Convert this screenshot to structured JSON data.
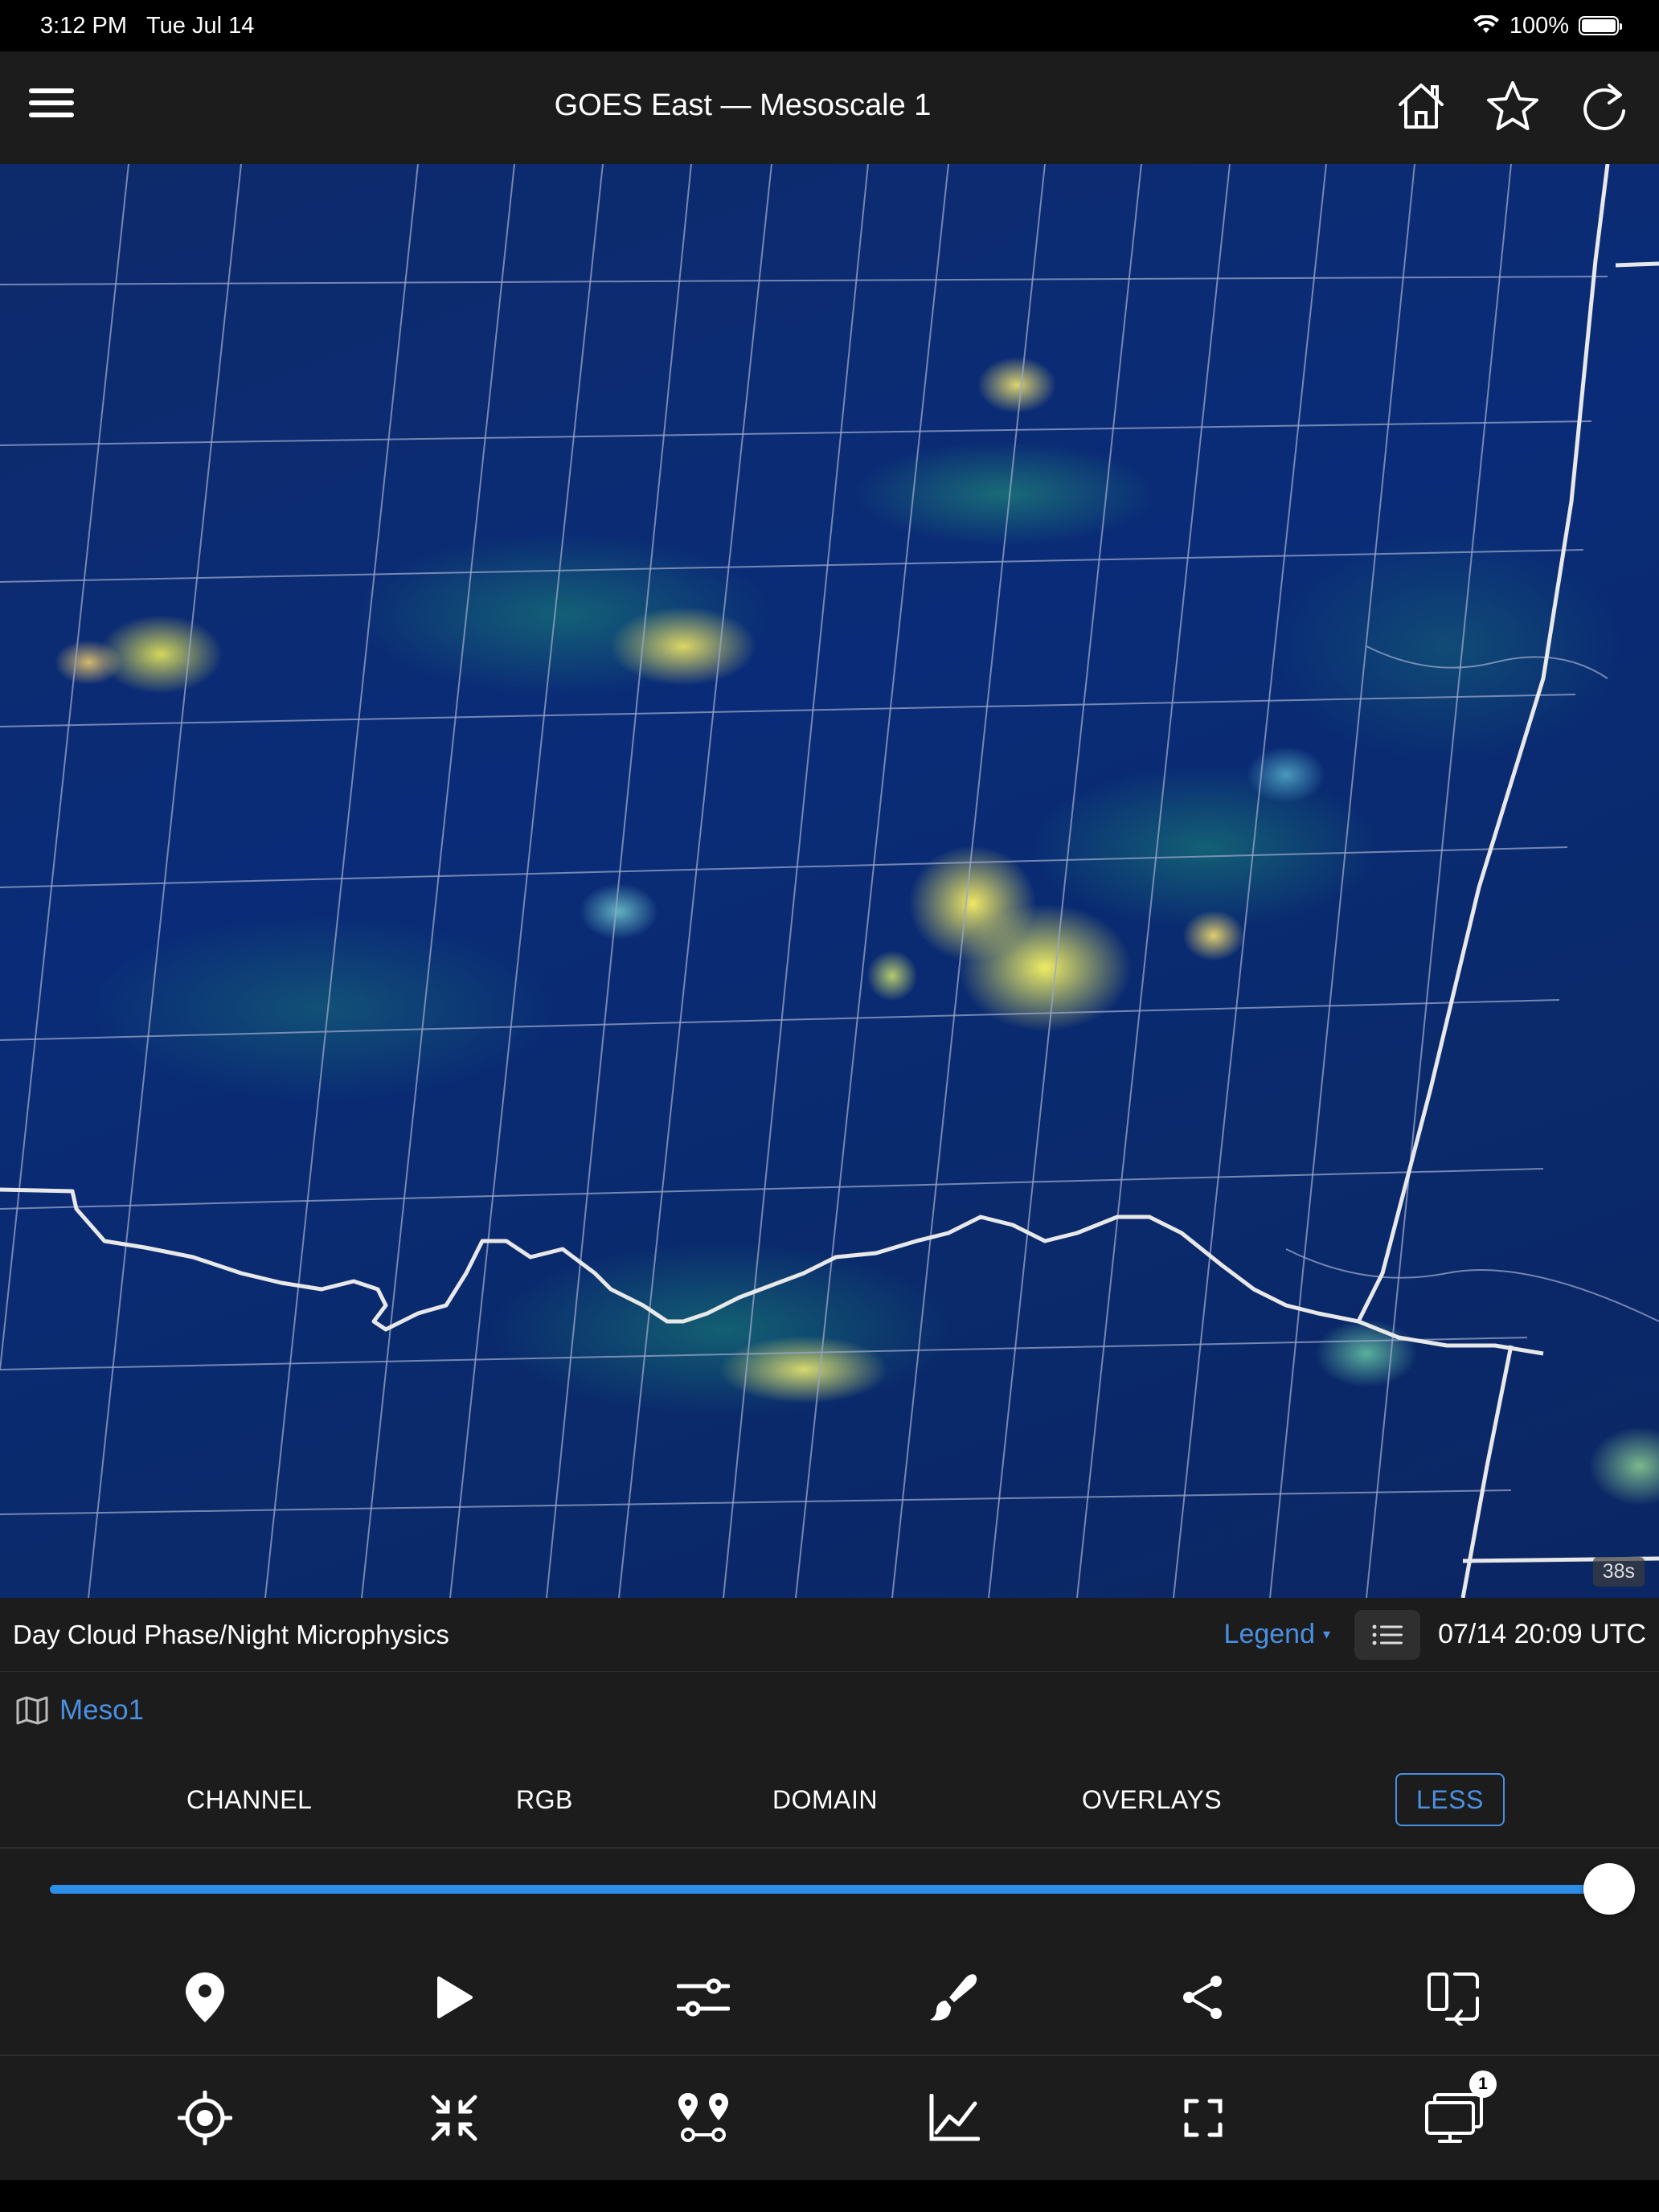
{
  "status_bar": {
    "time": "3:12 PM",
    "date": "Tue Jul 14",
    "battery": "100%"
  },
  "nav": {
    "title": "GOES East — Mesoscale 1",
    "icons": [
      "menu-icon",
      "home-icon",
      "star-icon",
      "refresh-icon"
    ]
  },
  "map": {
    "loop_badge": "38s"
  },
  "info_bar": {
    "product": "Day Cloud Phase/Night Microphysics",
    "legend_label": "Legend",
    "legend_caret": "▾",
    "timestamp": "07/14 20:09 UTC"
  },
  "domain": {
    "label": "Meso1",
    "icon": "map-icon"
  },
  "tabs": [
    {
      "label": "CHANNEL",
      "active": false
    },
    {
      "label": "RGB",
      "active": false
    },
    {
      "label": "DOMAIN",
      "active": false
    },
    {
      "label": "OVERLAYS",
      "active": false
    },
    {
      "label": "LESS",
      "active": true
    }
  ],
  "slider": {
    "value": 1.0,
    "accent_color": "#2d8fe8"
  },
  "toolbar_top": [
    "location-pin-icon",
    "play-icon",
    "sliders-icon",
    "brush-icon",
    "share-icon",
    "rotate-device-icon"
  ],
  "toolbar_bottom": [
    "crosshair-icon",
    "collapse-icon",
    "route-icon",
    "line-chart-icon",
    "fullscreen-icon",
    "monitor-icon"
  ],
  "monitor_badge": "1",
  "colors": {
    "accent": "#4a90e2",
    "bar_bg": "#1c1c1c"
  }
}
